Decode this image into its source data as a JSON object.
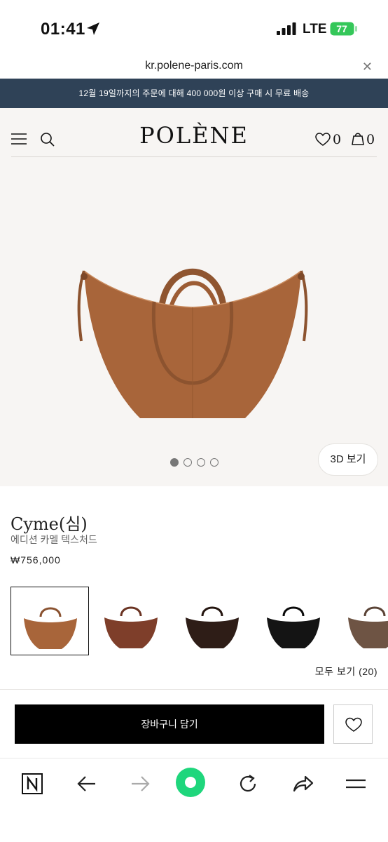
{
  "status_bar": {
    "time": "01:41",
    "network": "LTE",
    "battery": "77"
  },
  "url_bar": {
    "url": "kr.polene-paris.com"
  },
  "banner": {
    "text": "12월 19일까지의 주문에 대해 400 000원 이상 구매 시 무료 배송"
  },
  "header": {
    "logo": "POLÈNE",
    "wishlist_count": "0",
    "cart_count": "0"
  },
  "gallery": {
    "view_3d_label": "3D 보기",
    "slide_count": 4,
    "active_slide": 1
  },
  "product": {
    "name": "Cyme(심)",
    "color": "에디션 카멜 텍스처드",
    "price": "₩756,000"
  },
  "swatches": {
    "items": [
      {
        "name": "camel",
        "color": "#a8653a",
        "selected": true
      },
      {
        "name": "cognac",
        "color": "#7e3e2a",
        "selected": false
      },
      {
        "name": "dark-brown",
        "color": "#2e1d17",
        "selected": false
      },
      {
        "name": "black",
        "color": "#141414",
        "selected": false
      },
      {
        "name": "taupe",
        "color": "#6e5444",
        "selected": false
      }
    ],
    "see_all": "모두 보기 (20)"
  },
  "actions": {
    "add_to_cart": "장바구니 담기"
  },
  "colors": {
    "banner": "#2f4257",
    "bag": "#a8653a",
    "accent_green": "#1fd67c"
  },
  "toolbar": {
    "icons": [
      "naver-n-icon",
      "back-arrow-icon",
      "forward-arrow-icon",
      "home-green-icon",
      "reload-icon",
      "share-icon",
      "menu-icon"
    ]
  }
}
